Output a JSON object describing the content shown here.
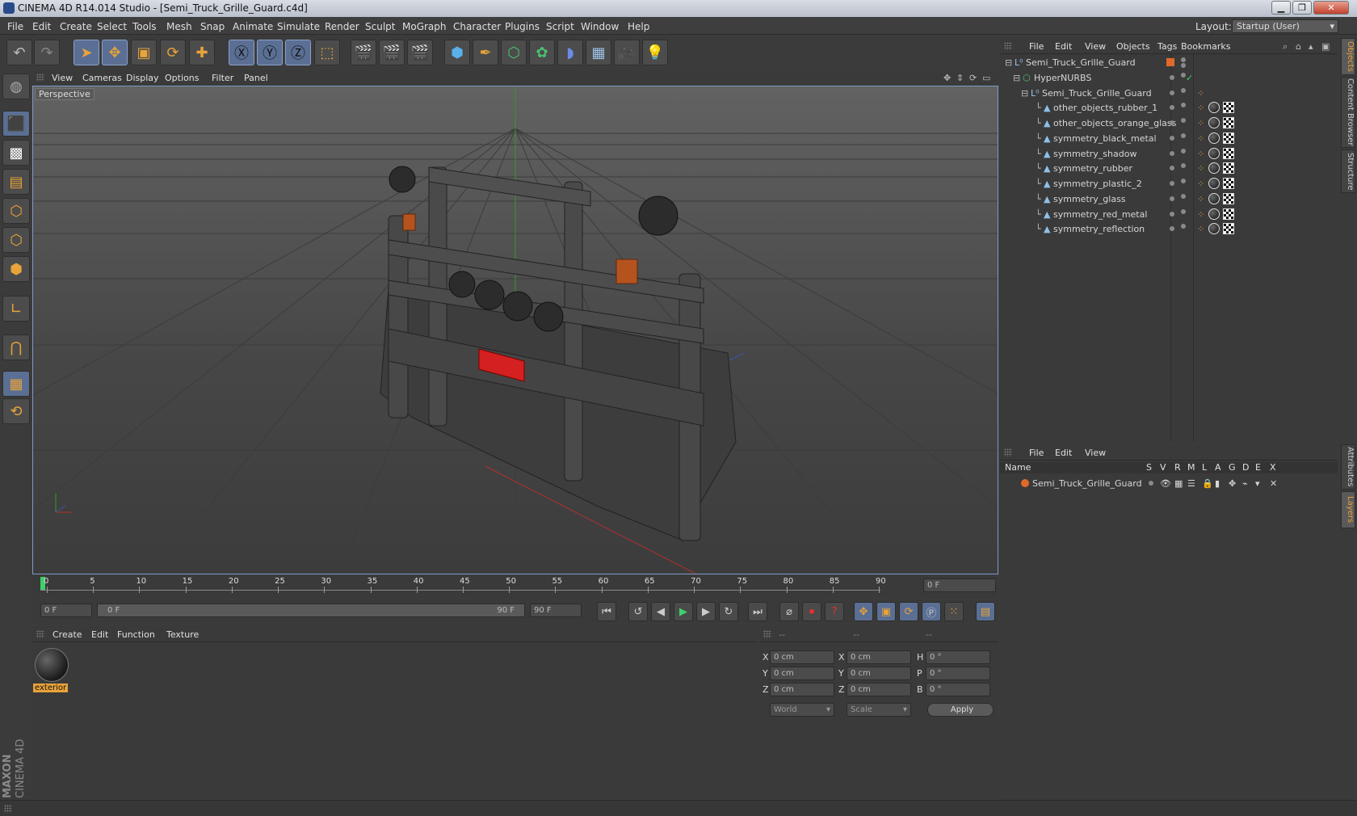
{
  "window": {
    "title": "CINEMA 4D R14.014 Studio - [Semi_Truck_Grille_Guard.c4d]",
    "minimize": "▁",
    "restore": "❐",
    "close": "✕"
  },
  "menu": [
    "File",
    "Edit",
    "Create",
    "Select",
    "Tools",
    "Mesh",
    "Snap",
    "Animate",
    "Simulate",
    "Render",
    "Sculpt",
    "MoGraph",
    "Character",
    "Plugins",
    "Script",
    "Window",
    "Help"
  ],
  "layout": {
    "label": "Layout:",
    "value": "Startup (User)"
  },
  "viewport": {
    "menu": [
      "View",
      "Cameras",
      "Display",
      "Options",
      "Filter",
      "Panel"
    ],
    "label": "Perspective"
  },
  "timeline": {
    "ticks": [
      "0",
      "5",
      "10",
      "15",
      "20",
      "25",
      "30",
      "35",
      "40",
      "45",
      "50",
      "55",
      "60",
      "65",
      "70",
      "75",
      "80",
      "85",
      "90"
    ],
    "current_frame": "0 F"
  },
  "transport": {
    "start": "0 F",
    "range_start": "0 F",
    "range_end": "90 F",
    "end": "90 F"
  },
  "material_manager": {
    "menu": [
      "Create",
      "Edit",
      "Function",
      "Texture"
    ],
    "materials": [
      {
        "name": "exterior"
      }
    ]
  },
  "coordinates": {
    "headers": [
      "--",
      "--",
      "--"
    ],
    "rows": [
      {
        "a": "X",
        "av": "0 cm",
        "b": "X",
        "bv": "0 cm",
        "c": "H",
        "cv": "0 °"
      },
      {
        "a": "Y",
        "av": "0 cm",
        "b": "Y",
        "bv": "0 cm",
        "c": "P",
        "cv": "0 °"
      },
      {
        "a": "Z",
        "av": "0 cm",
        "b": "Z",
        "bv": "0 cm",
        "c": "B",
        "cv": "0 °"
      }
    ],
    "world": "World",
    "scale": "Scale",
    "apply": "Apply"
  },
  "object_manager": {
    "menu": [
      "File",
      "Edit",
      "View",
      "Objects",
      "Tags",
      "Bookmarks"
    ],
    "objects": [
      {
        "name": "Semi_Truck_Grille_Guard"
      },
      {
        "name": "HyperNURBS"
      },
      {
        "name": "Semi_Truck_Grille_Guard"
      },
      {
        "name": "other_objects_rubber_1"
      },
      {
        "name": "other_objects_orange_glass"
      },
      {
        "name": "symmetry_black_metal"
      },
      {
        "name": "symmetry_shadow"
      },
      {
        "name": "symmetry_rubber"
      },
      {
        "name": "symmetry_plastic_2"
      },
      {
        "name": "symmetry_glass"
      },
      {
        "name": "symmetry_red_metal"
      },
      {
        "name": "symmetry_reflection"
      }
    ]
  },
  "layer_manager": {
    "menu": [
      "File",
      "Edit",
      "View"
    ],
    "columns": [
      "Name",
      "S",
      "V",
      "R",
      "M",
      "L",
      "A",
      "G",
      "D",
      "E",
      "X"
    ],
    "layers": [
      {
        "name": "Semi_Truck_Grille_Guard"
      }
    ]
  },
  "side_tabs": [
    "Objects",
    "Content Browser",
    "Structure",
    "Attributes",
    "Layers"
  ],
  "brand": {
    "line1": "MAXON",
    "line2": "CINEMA 4D"
  },
  "colors": {
    "accent": "#e8a33a",
    "viewport_border": "#7d9ac8",
    "layer_color": "#e06a2a"
  }
}
